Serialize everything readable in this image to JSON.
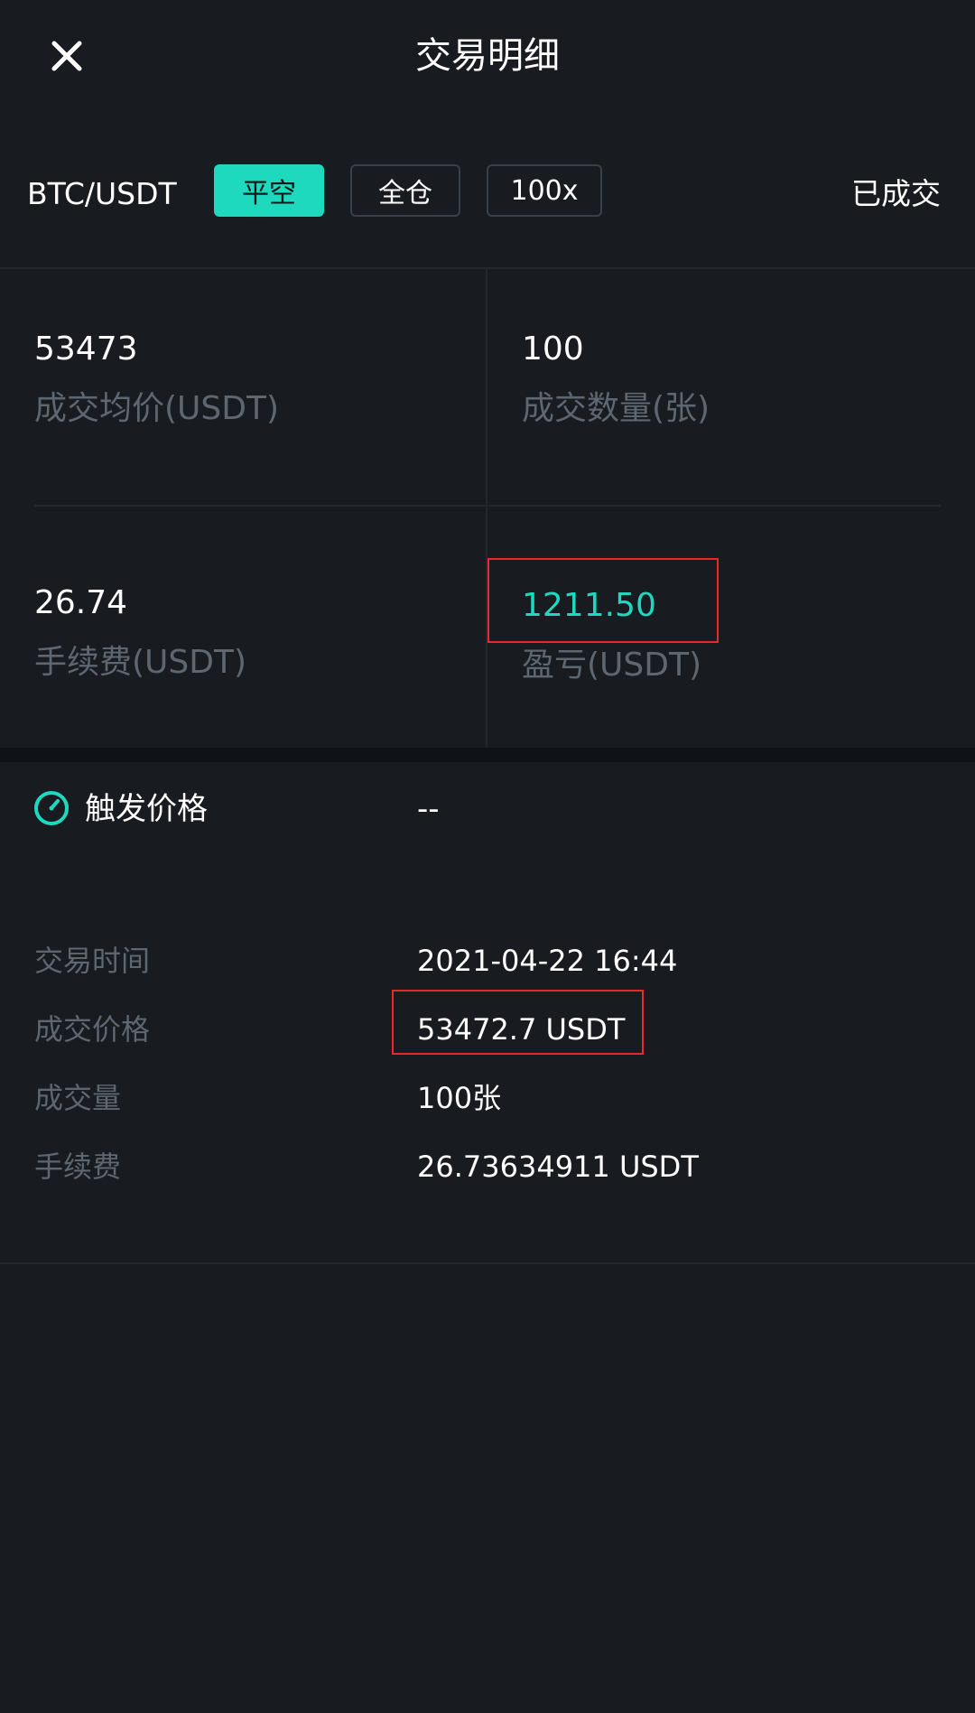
{
  "header": {
    "title": "交易明细",
    "close_icon": "close-icon"
  },
  "order": {
    "symbol": "BTC/USDT",
    "side_tag": "平空",
    "margin_tag": "全仓",
    "leverage_tag": "100x",
    "status": "已成交"
  },
  "stats": [
    {
      "value": "53473",
      "label": "成交均价(USDT)"
    },
    {
      "value": "100",
      "label": "成交数量(张)"
    },
    {
      "value": "26.74",
      "label": "手续费(USDT)"
    },
    {
      "value": "1211.50",
      "label": "盈亏(USDT)"
    }
  ],
  "trigger": {
    "icon": "gauge-icon",
    "label": "触发价格",
    "value": "--"
  },
  "details": [
    {
      "label": "交易时间",
      "value": "2021-04-22 16:44"
    },
    {
      "label": "成交价格",
      "value": "53472.7 USDT"
    },
    {
      "label": "成交量",
      "value": "100张"
    },
    {
      "label": "手续费",
      "value": "26.73634911 USDT"
    }
  ],
  "colors": {
    "background": "#181c21",
    "accent": "#1fd9be",
    "label_gray": "#5e6670",
    "highlight_red": "#e52b2b"
  }
}
